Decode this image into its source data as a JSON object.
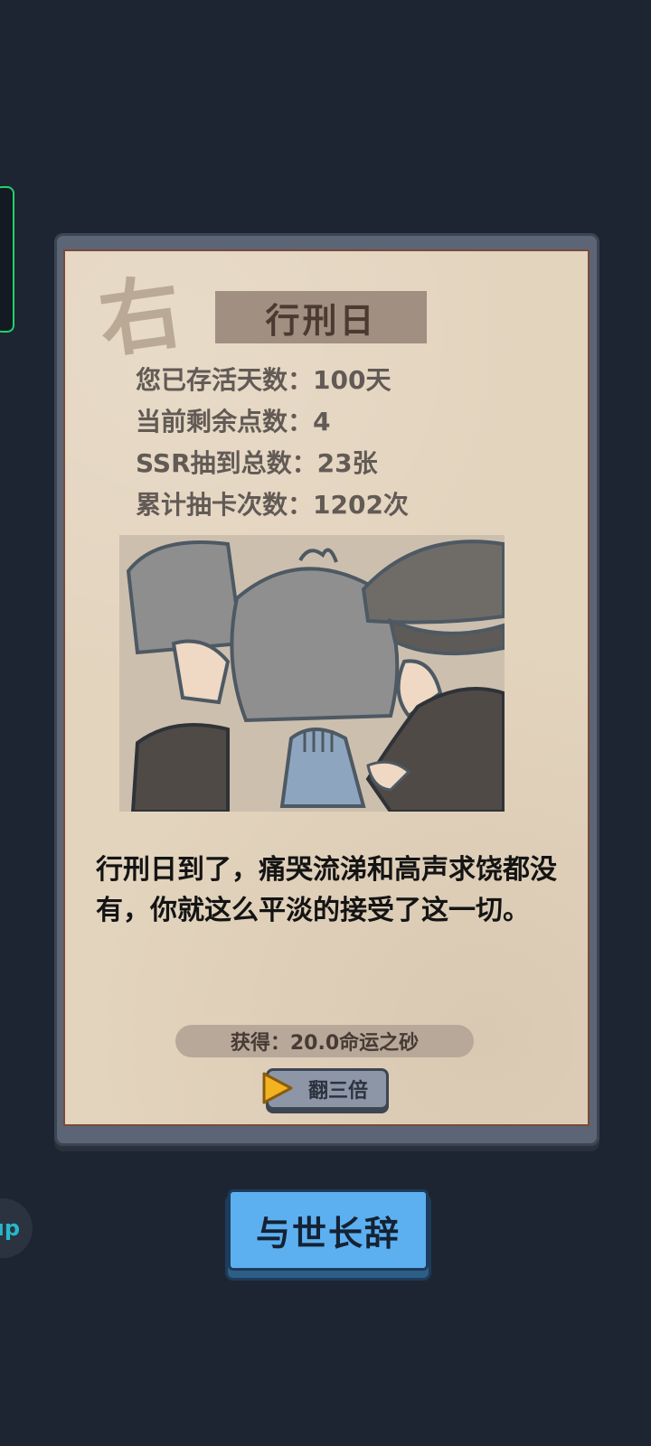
{
  "side_bubble": {
    "label": "ıp"
  },
  "card": {
    "title": "行刑日",
    "stamp_glyph": "右",
    "stats": [
      "您已存活天数：100天",
      "当前剩余点数：4",
      "SSR抽到总数：23张",
      "累计抽卡次数：1202次"
    ],
    "story": "行刑日到了，痛哭流涕和高声求饶都没有，你就这么平淡的接受了这一切。",
    "reward": "获得：20.0命运之砂",
    "triple_button": "翻三倍"
  },
  "farewell_button": "与世长辞",
  "colors": {
    "background": "#1e2532",
    "paper": "#e3d4be",
    "title_plate": "#a18f82",
    "farewell_button": "#5db0ef",
    "triple_button": "#8d96a6",
    "play_icon": "#f2b320"
  }
}
